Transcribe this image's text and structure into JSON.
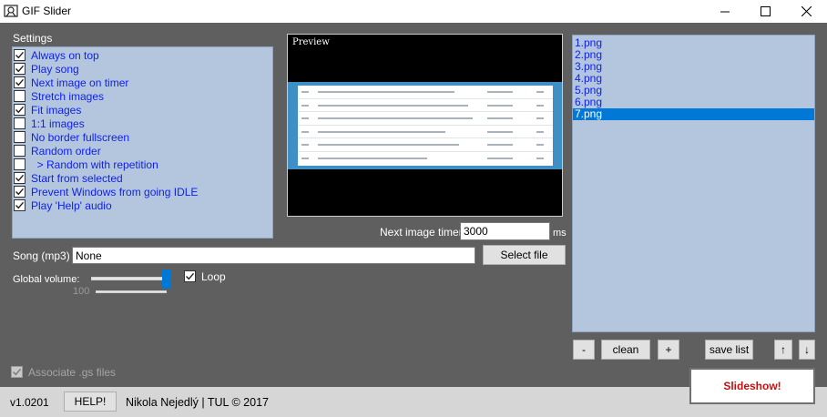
{
  "window": {
    "title": "GIF Slider"
  },
  "settings": {
    "label": "Settings",
    "items": [
      {
        "label": "Always on top",
        "checked": true
      },
      {
        "label": "Play song",
        "checked": true
      },
      {
        "label": "Next image on timer",
        "checked": true
      },
      {
        "label": "Stretch images",
        "checked": false
      },
      {
        "label": "Fit images",
        "checked": true
      },
      {
        "label": "1:1 images",
        "checked": false
      },
      {
        "label": "No border fullscreen",
        "checked": false
      },
      {
        "label": "Random order",
        "checked": false
      },
      {
        "label": "  > Random with repetition",
        "checked": false
      },
      {
        "label": "Start from selected",
        "checked": true
      },
      {
        "label": "Prevent Windows from going IDLE",
        "checked": true
      },
      {
        "label": "Play 'Help' audio",
        "checked": true
      }
    ]
  },
  "preview": {
    "label": "Preview"
  },
  "timer": {
    "label": "Next image timer",
    "value": "3000",
    "unit": "ms"
  },
  "song": {
    "label": "Song (mp3)",
    "value": "None",
    "select_label": "Select file"
  },
  "volume": {
    "label": "Global volume:",
    "value": "100",
    "level": 1.0
  },
  "loop": {
    "label": "Loop",
    "checked": true
  },
  "files": {
    "items": [
      "1.png",
      "2.png",
      "3.png",
      "4.png",
      "5.png",
      "6.png",
      "7.png"
    ],
    "selected_index": 6
  },
  "list_buttons": {
    "minus": "-",
    "clean": "clean",
    "plus": "+",
    "save": "save list",
    "up": "↑",
    "down": "↓"
  },
  "associate": {
    "label": "Associate .gs files",
    "checked": true
  },
  "status": {
    "version": "v1.0201",
    "help": "HELP!",
    "credits": "Nikola Nejedlý | TUL © 2017"
  },
  "slideshow": {
    "label": "Slideshow!"
  },
  "colors": {
    "panel": "#5f5f5f",
    "list_bg": "#b4c6de",
    "item_text": "#0c1ff1",
    "selection": "#0078d7",
    "slideshow_text": "#c21010"
  },
  "icons": {
    "app": "gif-slider-icon",
    "minimize": "minimize-icon",
    "maximize": "maximize-icon",
    "close": "close-icon"
  }
}
